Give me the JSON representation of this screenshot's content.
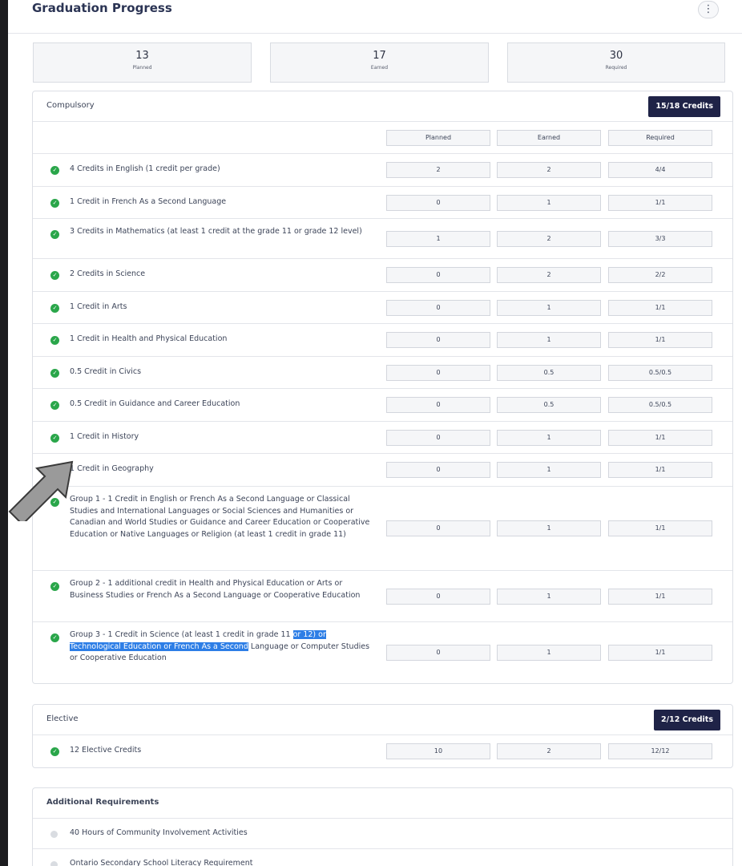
{
  "header": {
    "title": "Graduation Progress",
    "menu_icon": "more-vertical-icon"
  },
  "summary": [
    {
      "value": "13",
      "label": "Planned"
    },
    {
      "value": "17",
      "label": "Earned"
    },
    {
      "value": "30",
      "label": "Required"
    }
  ],
  "compulsory": {
    "title": "Compulsory",
    "badge": "15/18 Credits",
    "columns": [
      "Planned",
      "Earned",
      "Required"
    ],
    "rows": [
      {
        "text": "4 Credits in English (1 credit per grade)",
        "planned": "2",
        "earned": "2",
        "required": "4/4"
      },
      {
        "text": "1 Credit in French As a Second Language",
        "planned": "0",
        "earned": "1",
        "required": "1/1"
      },
      {
        "text": "3 Credits in Mathematics (at least 1 credit at the grade 11 or grade 12 level)",
        "planned": "1",
        "earned": "2",
        "required": "3/3"
      },
      {
        "text": "2 Credits in Science",
        "planned": "0",
        "earned": "2",
        "required": "2/2"
      },
      {
        "text": "1 Credit in Arts",
        "planned": "0",
        "earned": "1",
        "required": "1/1"
      },
      {
        "text": "1 Credit in Health and Physical Education",
        "planned": "0",
        "earned": "1",
        "required": "1/1"
      },
      {
        "text": "0.5 Credit in Civics",
        "planned": "0",
        "earned": "0.5",
        "required": "0.5/0.5"
      },
      {
        "text": "0.5 Credit in Guidance and Career Education",
        "planned": "0",
        "earned": "0.5",
        "required": "0.5/0.5"
      },
      {
        "text": "1 Credit in History",
        "planned": "0",
        "earned": "1",
        "required": "1/1"
      },
      {
        "text": "1 Credit in Geography",
        "planned": "0",
        "earned": "1",
        "required": "1/1"
      },
      {
        "text": "Group 1 - 1 Credit in English or French As a Second Language or Classical Studies and International Languages or Social Sciences and Humanities or Canadian and World Studies or Guidance and Career Education or Cooperative Education or Native Languages or Religion (at least 1 credit in grade 11)",
        "planned": "0",
        "earned": "1",
        "required": "1/1"
      },
      {
        "text": "Group 2 - 1 additional credit in Health and Physical Education or Arts or Business Studies or French As a Second Language or Cooperative Education",
        "planned": "0",
        "earned": "1",
        "required": "1/1"
      },
      {
        "text_before": "Group 3 - 1 Credit in Science (at least 1 credit in grade 11",
        "text_highlight": "or 12) or Technological Education or French As a Second",
        "text_after": "Language or Computer Studies or Cooperative Education",
        "planned": "0",
        "earned": "1",
        "required": "1/1"
      }
    ]
  },
  "elective": {
    "title": "Elective",
    "badge": "2/12 Credits",
    "rows": [
      {
        "text": "12 Elective Credits",
        "planned": "10",
        "earned": "2",
        "required": "12/12"
      }
    ]
  },
  "additional": {
    "title": "Additional Requirements",
    "rows": [
      {
        "text": "40 Hours of Community Involvement Activities"
      },
      {
        "text": "Ontario Secondary School Literacy Requirement"
      }
    ]
  },
  "icons": {
    "check": "check-circle-icon",
    "pending": "pending-circle-icon",
    "arrow": "pointer-arrow-icon"
  },
  "colors": {
    "badge": "#1f2347",
    "check": "#2aa64a",
    "highlight": "#2d7ee6",
    "arrow": "#9a9a9a"
  }
}
